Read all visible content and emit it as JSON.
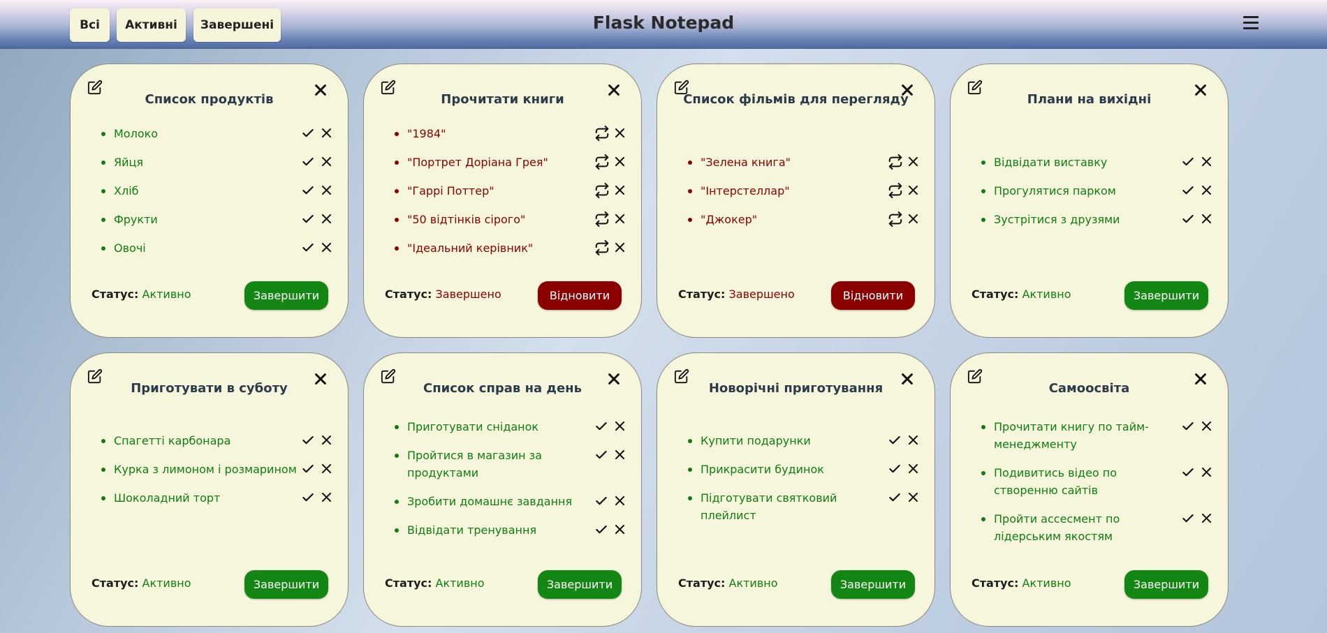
{
  "app": {
    "title": "Flask Notepad"
  },
  "filters": [
    {
      "label": "Всі"
    },
    {
      "label": "Активні"
    },
    {
      "label": "Завершені"
    }
  ],
  "status_label": "Статус:",
  "colors": {
    "active": "#0f7d0f",
    "done": "#8b0000",
    "card_bg": "#f6f6dc"
  },
  "notes": [
    {
      "title": "Список продуктів",
      "status": "Активно",
      "state": "active",
      "action_label": "Завершити",
      "items": [
        {
          "text": "Молоко"
        },
        {
          "text": "Яйця"
        },
        {
          "text": "Хліб"
        },
        {
          "text": "Фрукти"
        },
        {
          "text": "Овочі"
        }
      ]
    },
    {
      "title": "Прочитати книги",
      "status": "Завершено",
      "state": "done",
      "action_label": "Відновити",
      "items": [
        {
          "text": "\"1984\""
        },
        {
          "text": "\"Портрет Доріана Грея\""
        },
        {
          "text": "\"Гаррі Поттер\""
        },
        {
          "text": "\"50 відтінків сірого\""
        },
        {
          "text": "\"Ідеальний керівник\""
        }
      ]
    },
    {
      "title": "Список фільмів для перегляду",
      "status": "Завершено",
      "state": "done",
      "action_label": "Відновити",
      "items": [
        {
          "text": "\"Зелена книга\""
        },
        {
          "text": "\"Інтерстеллар\""
        },
        {
          "text": "\"Джокер\""
        }
      ]
    },
    {
      "title": "Плани на вихідні",
      "status": "Активно",
      "state": "active",
      "action_label": "Завершити",
      "items": [
        {
          "text": "Відвідати виставку"
        },
        {
          "text": "Прогулятися парком"
        },
        {
          "text": "Зустрітися з друзями"
        }
      ]
    },
    {
      "title": "Приготувати в суботу",
      "status": "Активно",
      "state": "active",
      "action_label": "Завершити",
      "items": [
        {
          "text": "Спагетті карбонара"
        },
        {
          "text": "Курка з лимоном і розмарином"
        },
        {
          "text": "Шоколадний торт"
        }
      ]
    },
    {
      "title": "Список справ на день",
      "status": "Активно",
      "state": "active",
      "action_label": "Завершити",
      "items": [
        {
          "text": "Приготувати сніданок"
        },
        {
          "text": "Пройтися в магазин за продуктами"
        },
        {
          "text": "Зробити домашнє завдання"
        },
        {
          "text": "Відвідати тренування"
        }
      ]
    },
    {
      "title": "Новорічні приготування",
      "status": "Активно",
      "state": "active",
      "action_label": "Завершити",
      "items": [
        {
          "text": "Купити подарунки"
        },
        {
          "text": "Прикрасити будинок"
        },
        {
          "text": "Підготувати святковий плейлист"
        }
      ]
    },
    {
      "title": "Самоосвіта",
      "status": "Активно",
      "state": "active",
      "action_label": "Завершити",
      "items": [
        {
          "text": "Прочитати книгу по тайм-менеджменту"
        },
        {
          "text": "Подивитись відео по створенню сайтів"
        },
        {
          "text": "Пройти ассесмент по лідерським якостям"
        }
      ]
    }
  ]
}
